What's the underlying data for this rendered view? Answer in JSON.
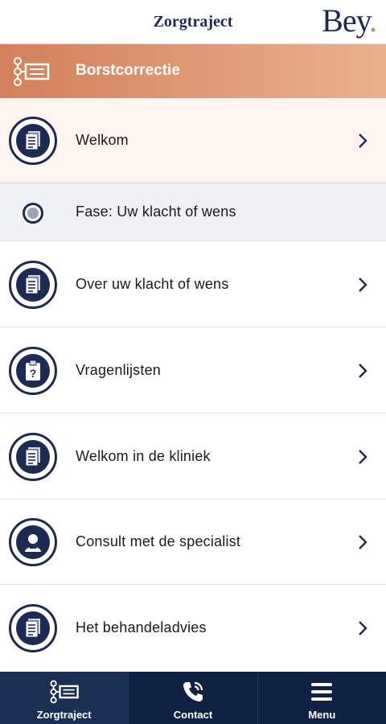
{
  "header": {
    "title": "Zorgtraject",
    "brand": "Bey",
    "brand_dot": "."
  },
  "banner": {
    "title": "Borstcorrectie",
    "icon": "care-path-icon"
  },
  "items": [
    {
      "label": "Welkom",
      "icon": "document-icon",
      "type": "step",
      "active": true
    },
    {
      "label": "Fase: Uw klacht of wens",
      "type": "phase"
    },
    {
      "label": "Over uw klacht of wens",
      "icon": "document-icon",
      "type": "step"
    },
    {
      "label": "Vragenlijsten",
      "icon": "clipboard-question-icon",
      "type": "step"
    },
    {
      "label": "Welkom in de kliniek",
      "icon": "document-icon",
      "type": "step"
    },
    {
      "label": "Consult met de specialist",
      "icon": "person-icon",
      "type": "step"
    },
    {
      "label": "Het behandeladvies",
      "icon": "document-icon",
      "type": "step"
    }
  ],
  "nav": [
    {
      "label": "Zorgtraject",
      "icon": "care-path-icon",
      "active": true
    },
    {
      "label": "Contact",
      "icon": "phone-icon"
    },
    {
      "label": "Menu",
      "icon": "hamburger-menu-icon"
    }
  ],
  "colors": {
    "navy": "#1d2a52",
    "accent": "#d47f5b",
    "nav_bg": "#0f2244"
  }
}
